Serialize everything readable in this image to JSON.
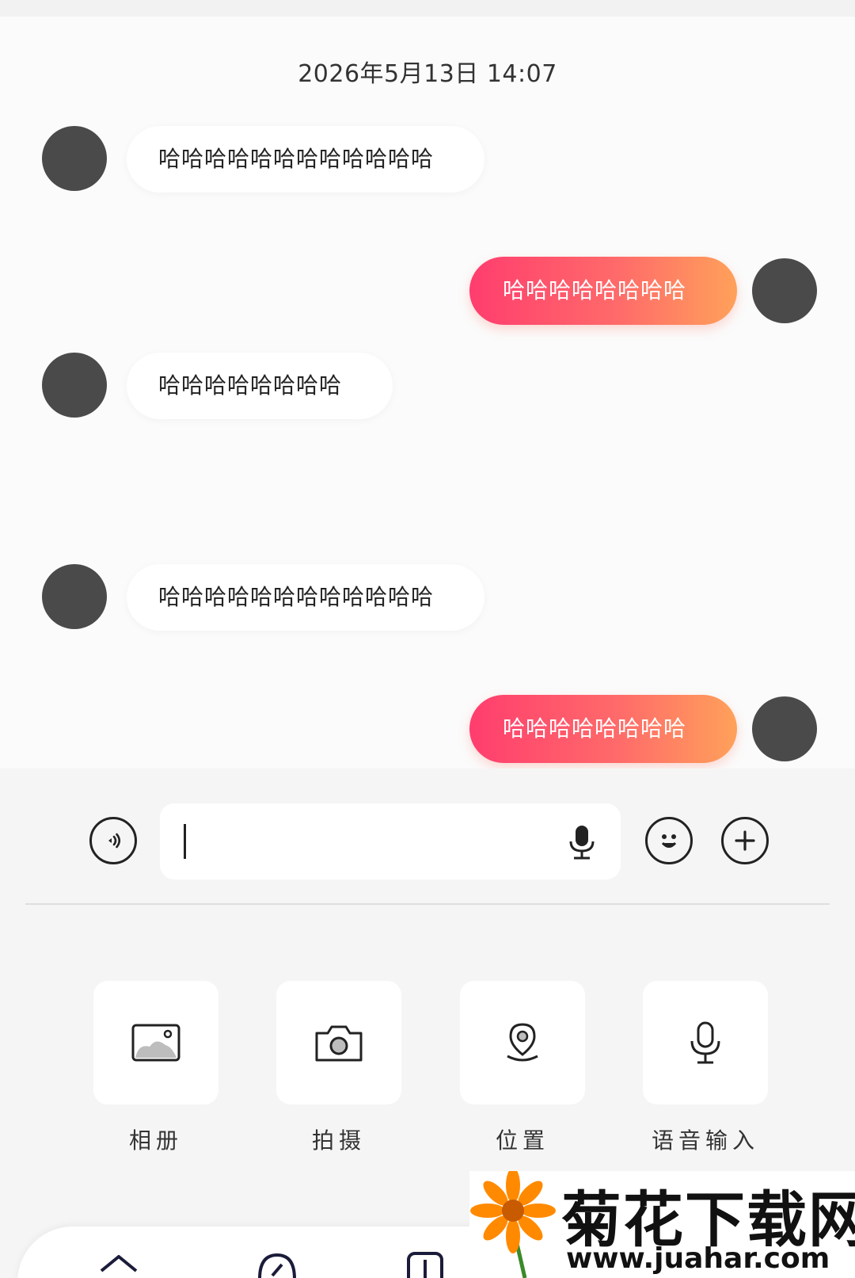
{
  "chat": {
    "timestamp": "2026年5月13日 14:07",
    "messages": [
      {
        "side": "in",
        "text": "哈哈哈哈哈哈哈哈哈哈哈哈"
      },
      {
        "side": "out",
        "text": "哈哈哈哈哈哈哈哈"
      },
      {
        "side": "in",
        "text": "哈哈哈哈哈哈哈哈"
      },
      {
        "side": "in",
        "text": "哈哈哈哈哈哈哈哈哈哈哈哈"
      },
      {
        "side": "out",
        "text": "哈哈哈哈哈哈哈哈"
      }
    ]
  },
  "composer": {
    "value": "",
    "icons": {
      "voice_toggle": "voice-wave-icon",
      "mic": "microphone-icon",
      "emoji": "smiley-icon",
      "more": "plus-icon"
    }
  },
  "actions": [
    {
      "label": "相册",
      "icon": "photo-album-icon"
    },
    {
      "label": "拍摄",
      "icon": "camera-icon"
    },
    {
      "label": "位置",
      "icon": "location-pin-icon"
    },
    {
      "label": "语音输入",
      "icon": "microphone-icon"
    }
  ],
  "colors": {
    "outgoing_gradient_start": "#ff3d6e",
    "outgoing_gradient_end": "#ffa15a",
    "avatar": "#4a4a4a"
  },
  "watermark": {
    "title": "菊花下载网",
    "url": "www.juahar.com"
  }
}
